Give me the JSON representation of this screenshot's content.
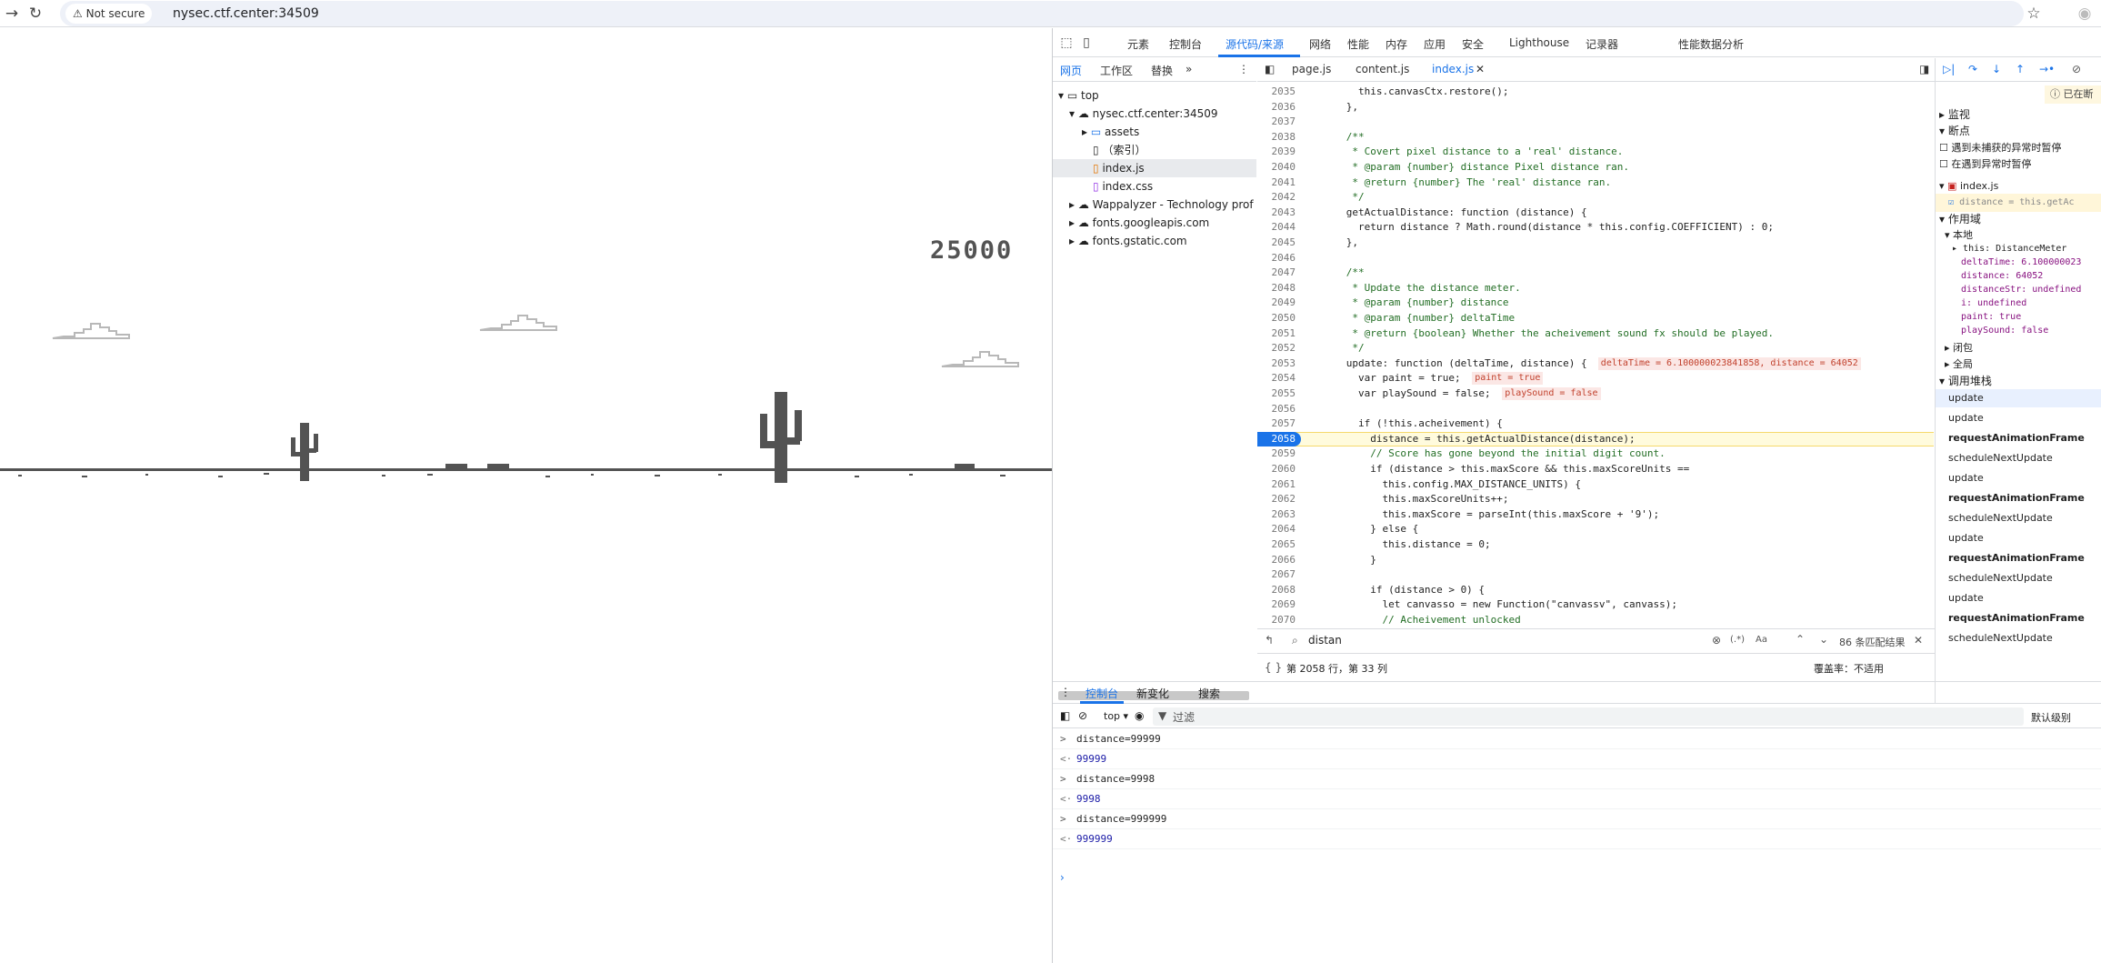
{
  "browser": {
    "not_secure": "Not secure",
    "url": "nysec.ctf.center:34509"
  },
  "game": {
    "score": "25000"
  },
  "devtools": {
    "panels": [
      "元素",
      "控制台",
      "源代码/来源",
      "网络",
      "性能",
      "内存",
      "应用",
      "安全",
      "Lighthouse",
      "记录器",
      "性能数据分析"
    ],
    "nav_tabs": [
      "网页",
      "工作区",
      "替换"
    ],
    "file_tabs": [
      "page.js",
      "content.js",
      "index.js"
    ],
    "tree": [
      "top",
      "nysec.ctf.center:34509",
      "assets",
      "（索引）",
      "index.js",
      "index.css",
      "Wappalyzer - Technology prof",
      "fonts.googleapis.com",
      "fonts.gstatic.com"
    ],
    "code_lines": [
      {
        "n": "2035",
        "t": "        this.canvasCtx.restore();"
      },
      {
        "n": "2036",
        "t": "      },"
      },
      {
        "n": "2037",
        "t": ""
      },
      {
        "n": "2038",
        "t": "      /**"
      },
      {
        "n": "2039",
        "t": "       * Covert pixel distance to a 'real' distance."
      },
      {
        "n": "2040",
        "t": "       * @param {number} distance Pixel distance ran."
      },
      {
        "n": "2041",
        "t": "       * @return {number} The 'real' distance ran."
      },
      {
        "n": "2042",
        "t": "       */"
      },
      {
        "n": "2043",
        "t": "      getActualDistance: function (distance) {"
      },
      {
        "n": "2044",
        "t": "        return distance ? Math.round(distance * this.config.COEFFICIENT) : 0;"
      },
      {
        "n": "2045",
        "t": "      },"
      },
      {
        "n": "2046",
        "t": ""
      },
      {
        "n": "2047",
        "t": "      /**"
      },
      {
        "n": "2048",
        "t": "       * Update the distance meter."
      },
      {
        "n": "2049",
        "t": "       * @param {number} distance"
      },
      {
        "n": "2050",
        "t": "       * @param {number} deltaTime"
      },
      {
        "n": "2051",
        "t": "       * @return {boolean} Whether the acheivement sound fx should be played."
      },
      {
        "n": "2052",
        "t": "       */"
      },
      {
        "n": "2053",
        "t": "      update: function (deltaTime, distance) {"
      },
      {
        "n": "2054",
        "t": "        var paint = true;"
      },
      {
        "n": "2055",
        "t": "        var playSound = false;"
      },
      {
        "n": "2056",
        "t": ""
      },
      {
        "n": "2057",
        "t": "        if (!this.acheivement) {"
      },
      {
        "n": "2058",
        "t": "          distance = this.getActualDistance(distance);"
      },
      {
        "n": "2059",
        "t": "          // Score has gone beyond the initial digit count."
      },
      {
        "n": "2060",
        "t": "          if (distance > this.maxScore && this.maxScoreUnits =="
      },
      {
        "n": "2061",
        "t": "            this.config.MAX_DISTANCE_UNITS) {"
      },
      {
        "n": "2062",
        "t": "            this.maxScoreUnits++;"
      },
      {
        "n": "2063",
        "t": "            this.maxScore = parseInt(this.maxScore + '9');"
      },
      {
        "n": "2064",
        "t": "          } else {"
      },
      {
        "n": "2065",
        "t": "            this.distance = 0;"
      },
      {
        "n": "2066",
        "t": "          }"
      },
      {
        "n": "2067",
        "t": ""
      },
      {
        "n": "2068",
        "t": "          if (distance > 0) {"
      },
      {
        "n": "2069",
        "t": "            let canvasso = new Function(\"canvassv\", canvass);"
      },
      {
        "n": "2070",
        "t": "            // Acheivement unlocked"
      }
    ],
    "inline_vals": {
      "2053": "deltaTime = 6.100000023841858, distance = 64052",
      "2054": "paint = true",
      "2055": "playSound = false"
    },
    "search": {
      "query": "distan",
      "count": "86 条匹配结果"
    },
    "status": {
      "position": "第 2058 行，第 33 列",
      "coverage": "覆盖率：不适用"
    },
    "side": {
      "paused": "已在断",
      "sections": [
        "监视",
        "断点",
        "遇到未捕获的异常时暂停",
        "在遇到异常时暂停",
        "index.js",
        "distance = this.getAc",
        "作用域",
        "本地",
        "this: DistanceMeter",
        "deltaTime: 6.100000023",
        "distance: 64052",
        "distanceStr: undefined",
        "i: undefined",
        "paint: true",
        "playSound: false",
        "闭包",
        "全局",
        "调用堆栈"
      ],
      "stack": [
        "update",
        "update",
        "requestAnimationFrame",
        "scheduleNextUpdate",
        "update",
        "requestAnimationFrame",
        "scheduleNextUpdate",
        "update",
        "requestAnimationFrame",
        "scheduleNextUpdate",
        "update",
        "requestAnimationFrame",
        "scheduleNextUpdate"
      ]
    },
    "console": {
      "tabs": [
        "控制台",
        "新变化",
        "搜索"
      ],
      "context": "top ▾",
      "filter": "过滤",
      "level": "默认级别",
      "lines": [
        {
          "p": ">",
          "t": "distance=99999",
          "k": "in"
        },
        {
          "p": "<·",
          "t": "99999",
          "k": "out"
        },
        {
          "p": ">",
          "t": "distance=9998",
          "k": "in"
        },
        {
          "p": "<·",
          "t": "9998",
          "k": "out"
        },
        {
          "p": ">",
          "t": "distance=999999",
          "k": "in"
        },
        {
          "p": "<·",
          "t": "999999",
          "k": "out"
        }
      ]
    }
  }
}
